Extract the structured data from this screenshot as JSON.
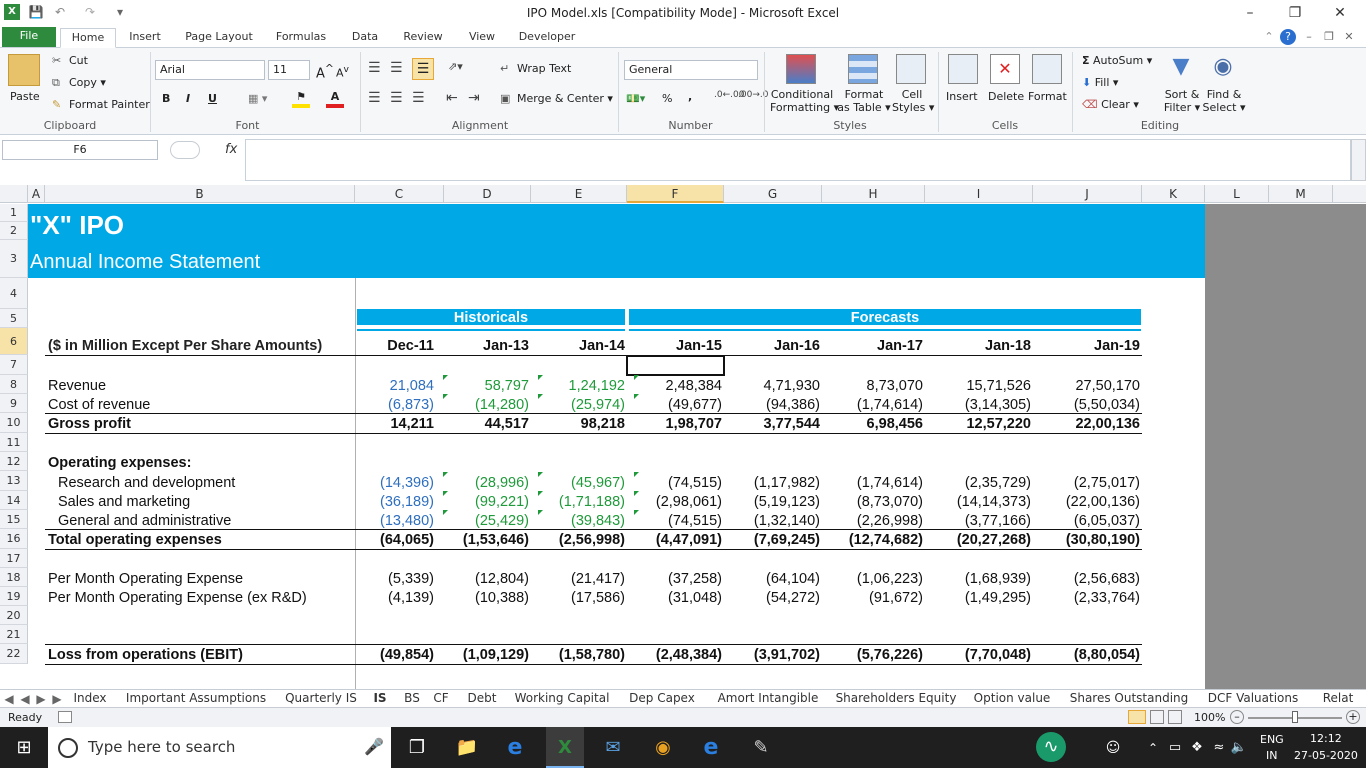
{
  "window": {
    "title": "IPO Model.xls  [Compatibility Mode]  -  Microsoft Excel"
  },
  "ribbon": {
    "tabs": [
      "File",
      "Home",
      "Insert",
      "Page Layout",
      "Formulas",
      "Data",
      "Review",
      "View",
      "Developer"
    ],
    "active_tab": "Home",
    "clipboard": {
      "paste": "Paste",
      "cut": "Cut",
      "copy": "Copy",
      "format_painter": "Format Painter",
      "label": "Clipboard"
    },
    "font": {
      "name": "Arial",
      "size": "11",
      "label": "Font",
      "bold": "B",
      "italic": "I",
      "underline": "U"
    },
    "alignment": {
      "wrap_text": "Wrap Text",
      "merge_center": "Merge & Center",
      "label": "Alignment"
    },
    "number": {
      "format": "General",
      "percent": "%",
      "comma": ",",
      "label": "Number"
    },
    "styles": {
      "conditional": "Conditional",
      "conditional2": "Formatting",
      "format_as": "Format",
      "format_as2": "as Table",
      "cell": "Cell",
      "cell2": "Styles",
      "label": "Styles"
    },
    "cells": {
      "insert": "Insert",
      "delete": "Delete",
      "format": "Format",
      "label": "Cells"
    },
    "editing": {
      "autosum": "AutoSum",
      "fill": "Fill",
      "clear": "Clear",
      "sort": "Sort &",
      "sort2": "Filter",
      "find": "Find &",
      "find2": "Select",
      "label": "Editing"
    }
  },
  "formula_bar": {
    "name_box": "F6",
    "fx": "fx",
    "formula": ""
  },
  "columns": [
    "A",
    "B",
    "C",
    "D",
    "E",
    "F",
    "G",
    "H",
    "I",
    "J",
    "K",
    "L",
    "M"
  ],
  "rows": [
    "1",
    "2",
    "3",
    "4",
    "5",
    "6",
    "7",
    "8",
    "9",
    "10",
    "11",
    "12",
    "13",
    "14",
    "15",
    "16",
    "17",
    "18",
    "19",
    "20",
    "21",
    "22"
  ],
  "sheet": {
    "title": "\"X\" IPO",
    "subtitle": "Annual Income Statement",
    "historicals": "Historicals",
    "forecasts": "Forecasts",
    "units_label": "($ in Million Except Per Share Amounts)",
    "periods": [
      "Dec-11",
      "Jan-13",
      "Jan-14",
      "Jan-15",
      "Jan-16",
      "Jan-17",
      "Jan-18",
      "Jan-19"
    ],
    "lines": {
      "revenue": {
        "label": "Revenue",
        "values": [
          "21,084",
          "58,797",
          "1,24,192",
          "2,48,384",
          "4,71,930",
          "8,73,070",
          "15,71,526",
          "27,50,170"
        ]
      },
      "cost_of_revenue": {
        "label": "Cost of revenue",
        "values": [
          "(6,873)",
          "(14,280)",
          "(25,974)",
          "(49,677)",
          "(94,386)",
          "(1,74,614)",
          "(3,14,305)",
          "(5,50,034)"
        ]
      },
      "gross_profit": {
        "label": "Gross profit",
        "values": [
          "14,211",
          "44,517",
          "98,218",
          "1,98,707",
          "3,77,544",
          "6,98,456",
          "12,57,220",
          "22,00,136"
        ]
      },
      "opex_header": {
        "label": "Operating expenses:"
      },
      "rnd": {
        "label": "Research and development",
        "values": [
          "(14,396)",
          "(28,996)",
          "(45,967)",
          "(74,515)",
          "(1,17,982)",
          "(1,74,614)",
          "(2,35,729)",
          "(2,75,017)"
        ]
      },
      "sales_marketing": {
        "label": "Sales and marketing",
        "values": [
          "(36,189)",
          "(99,221)",
          "(1,71,188)",
          "(2,98,061)",
          "(5,19,123)",
          "(8,73,070)",
          "(14,14,373)",
          "(22,00,136)"
        ]
      },
      "gna": {
        "label": "General and administrative",
        "values": [
          "(13,480)",
          "(25,429)",
          "(39,843)",
          "(74,515)",
          "(1,32,140)",
          "(2,26,998)",
          "(3,77,166)",
          "(6,05,037)"
        ]
      },
      "total_opex": {
        "label": "Total operating expenses",
        "values": [
          "(64,065)",
          "(1,53,646)",
          "(2,56,998)",
          "(4,47,091)",
          "(7,69,245)",
          "(12,74,682)",
          "(20,27,268)",
          "(30,80,190)"
        ]
      },
      "per_month_opex": {
        "label": "Per Month Operating Expense",
        "values": [
          "(5,339)",
          "(12,804)",
          "(21,417)",
          "(37,258)",
          "(64,104)",
          "(1,06,223)",
          "(1,68,939)",
          "(2,56,683)"
        ]
      },
      "per_month_opex_ex": {
        "label": "Per Month Operating Expense (ex R&D)",
        "values": [
          "(4,139)",
          "(10,388)",
          "(17,586)",
          "(31,048)",
          "(54,272)",
          "(91,672)",
          "(1,49,295)",
          "(2,33,764)"
        ]
      },
      "ebit": {
        "label": "Loss from operations (EBIT)",
        "values": [
          "(49,854)",
          "(1,09,129)",
          "(1,58,780)",
          "(2,48,384)",
          "(3,91,702)",
          "(5,76,226)",
          "(7,70,048)",
          "(8,80,054)"
        ]
      }
    }
  },
  "sheet_tabs": [
    "Index",
    "Important Assumptions",
    "Quarterly IS",
    "IS",
    "BS",
    "CF",
    "Debt",
    "Working Capital",
    "Dep Capex",
    "Amort Intangible",
    "Shareholders Equity",
    "Option value",
    "Shares Outstanding",
    "DCF Valuations",
    "Relat"
  ],
  "active_sheet": "IS",
  "status": {
    "ready": "Ready",
    "zoom": "100%"
  },
  "taskbar": {
    "search_placeholder": "Type here to search",
    "lang": "ENG",
    "region": "IN",
    "time": "12:12",
    "date": "27-05-2020"
  },
  "colors": {
    "accent_blue": "#00a9e6",
    "excel_green": "#2e8b3d",
    "selection": "#f7e2a8"
  }
}
